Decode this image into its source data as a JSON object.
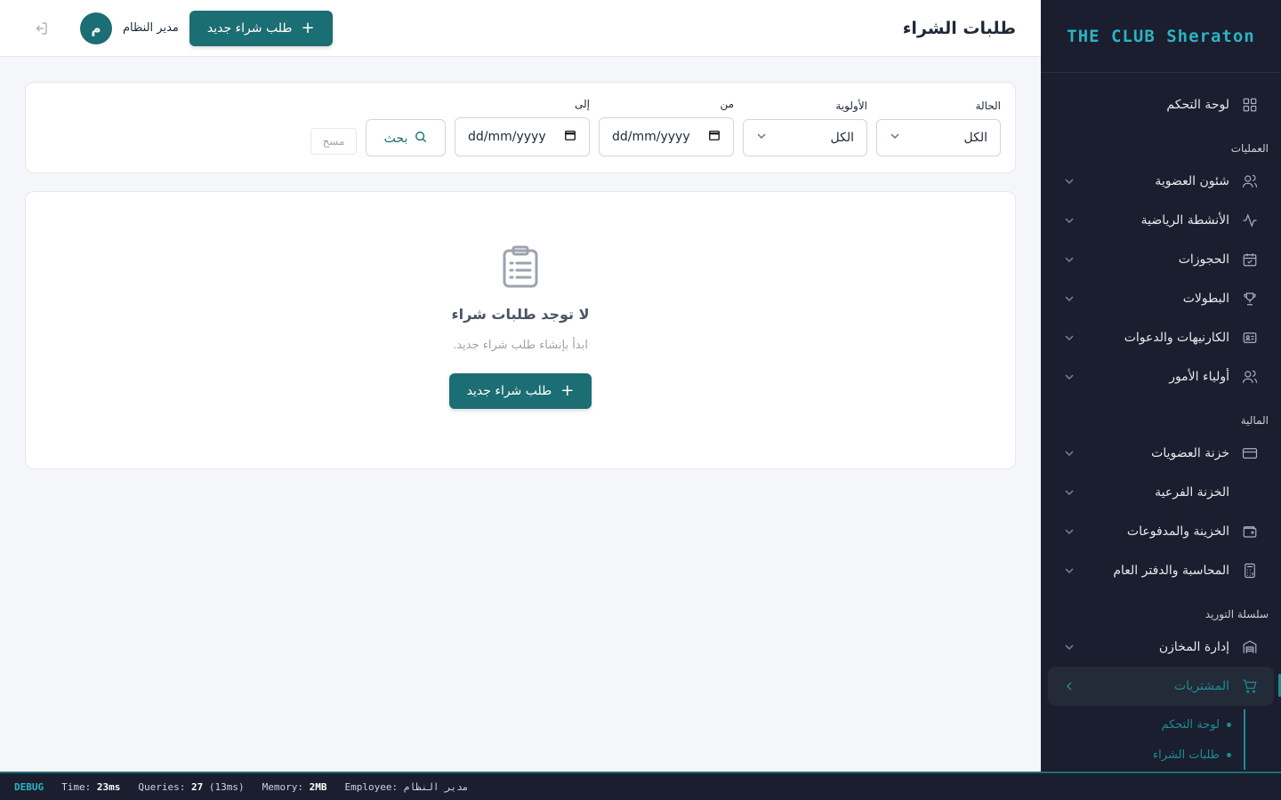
{
  "brand": "THE CLUB Sheraton",
  "sidebar": {
    "top": {
      "label": "لوحة التحكم",
      "icon": "grid-icon"
    },
    "sections": [
      {
        "title": "العمليات",
        "items": [
          {
            "label": "شئون العضوية",
            "icon": "users-icon"
          },
          {
            "label": "الأنشطة الرياضية",
            "icon": "activity-icon"
          },
          {
            "label": "الحجوزات",
            "icon": "calendar-check-icon"
          },
          {
            "label": "البطولات",
            "icon": "trophy-icon"
          },
          {
            "label": "الكارنيهات والدعوات",
            "icon": "id-card-icon"
          },
          {
            "label": "أولياء الأمور",
            "icon": "users-icon"
          }
        ]
      },
      {
        "title": "المالية",
        "items": [
          {
            "label": "خزنة العضويات",
            "icon": "credit-card-icon"
          },
          {
            "label": "الخزنة الفرعية",
            "icon": "none"
          },
          {
            "label": "الخزينة والمدفوعات",
            "icon": "wallet-icon"
          },
          {
            "label": "المحاسبة والدفتر العام",
            "icon": "calculator-icon"
          }
        ]
      },
      {
        "title": "سلسلة التوريد",
        "items": [
          {
            "label": "إدارة المخازن",
            "icon": "warehouse-icon"
          },
          {
            "label": "المشتريات",
            "icon": "cart-icon",
            "active": true
          }
        ]
      }
    ],
    "sub_items": [
      "لوحة التحكم",
      "طلبات الشراء"
    ]
  },
  "header": {
    "title": "طلبات الشراء",
    "new_button": "طلب شراء جديد",
    "user_name": "مدير النظام",
    "avatar_letter": "م"
  },
  "filters": {
    "status_label": "الحالة",
    "status_value": "الكل",
    "priority_label": "الأولوية",
    "priority_value": "الكل",
    "from_label": "من",
    "from_placeholder": "dd/mm/yyyy",
    "to_label": "إلى",
    "to_placeholder": "dd/mm/yyyy",
    "search_button": "بحث",
    "clear_button": "مسح"
  },
  "empty": {
    "title": "لا توجد طلبات شراء",
    "subtitle": "ابدأ بإنشاء طلب شراء جديد.",
    "button": "طلب شراء جديد"
  },
  "debug": {
    "tag": "DEBUG",
    "time_label": "Time:",
    "time_value": "23ms",
    "queries_label": "Queries:",
    "queries_value": "27",
    "queries_time": "(13ms)",
    "memory_label": "Memory:",
    "memory_value": "2MB",
    "employee_label": "Employee:",
    "employee_value": "مدير النظام"
  },
  "colors": {
    "primary": "#1b6e73",
    "sidebar_bg": "#1a1e2e",
    "brand": "#2cb3c4",
    "active": "#1e8c93"
  }
}
